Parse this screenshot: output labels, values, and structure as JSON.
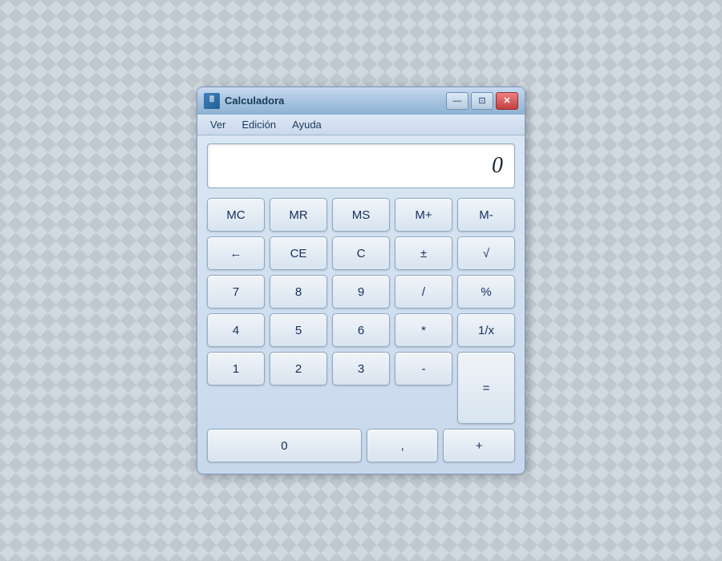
{
  "window": {
    "title": "Calculadora",
    "icon_label": "🖩"
  },
  "title_bar": {
    "minimize_label": "—",
    "restore_label": "⊡",
    "close_label": "✕"
  },
  "menu": {
    "items": [
      {
        "label": "Ver"
      },
      {
        "label": "Edición"
      },
      {
        "label": "Ayuda"
      }
    ]
  },
  "display": {
    "value": "0"
  },
  "buttons": {
    "row1": [
      {
        "label": "MC",
        "name": "mc-button"
      },
      {
        "label": "MR",
        "name": "mr-button"
      },
      {
        "label": "MS",
        "name": "ms-button"
      },
      {
        "label": "M+",
        "name": "mplus-button"
      },
      {
        "label": "M-",
        "name": "mminus-button"
      }
    ],
    "row2": [
      {
        "label": "←",
        "name": "backspace-button"
      },
      {
        "label": "CE",
        "name": "ce-button"
      },
      {
        "label": "C",
        "name": "c-button"
      },
      {
        "label": "±",
        "name": "plusminus-button"
      },
      {
        "label": "√",
        "name": "sqrt-button"
      }
    ],
    "row3": [
      {
        "label": "7",
        "name": "seven-button"
      },
      {
        "label": "8",
        "name": "eight-button"
      },
      {
        "label": "9",
        "name": "nine-button"
      },
      {
        "label": "/",
        "name": "divide-button"
      },
      {
        "label": "%",
        "name": "percent-button"
      }
    ],
    "row4": [
      {
        "label": "4",
        "name": "four-button"
      },
      {
        "label": "5",
        "name": "five-button"
      },
      {
        "label": "6",
        "name": "six-button"
      },
      {
        "label": "*",
        "name": "multiply-button"
      },
      {
        "label": "1/x",
        "name": "reciprocal-button"
      }
    ],
    "row5": [
      {
        "label": "1",
        "name": "one-button"
      },
      {
        "label": "2",
        "name": "two-button"
      },
      {
        "label": "3",
        "name": "three-button"
      },
      {
        "label": "-",
        "name": "subtract-button"
      }
    ],
    "bottom": {
      "zero": {
        "label": "0",
        "name": "zero-button"
      },
      "comma": {
        "label": ",",
        "name": "comma-button"
      },
      "plus": {
        "label": "+",
        "name": "add-button"
      },
      "equals": {
        "label": "=",
        "name": "equals-button"
      }
    }
  }
}
